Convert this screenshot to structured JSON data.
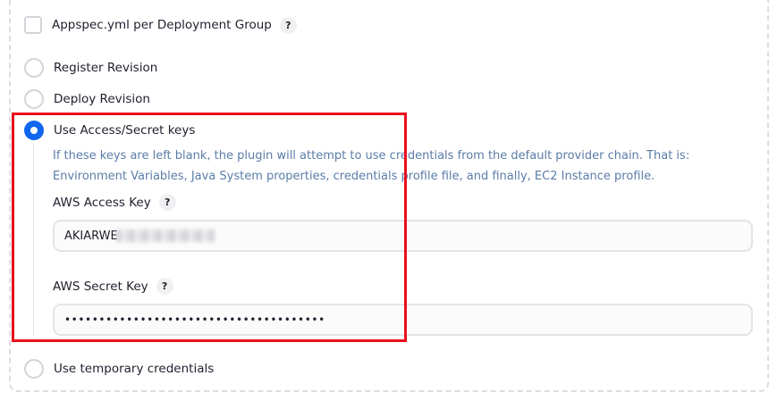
{
  "options": {
    "appspec_per_group": {
      "label": "Appspec.yml per Deployment Group",
      "help": "?"
    },
    "register_revision": {
      "label": "Register Revision"
    },
    "deploy_revision": {
      "label": "Deploy Revision"
    },
    "use_access_keys": {
      "label": "Use Access/Secret keys",
      "description": "If these keys are left blank, the plugin will attempt to use credentials from the default provider chain. That is: Environment Variables, Java System properties, credentials profile file, and finally, EC2 Instance profile."
    },
    "use_temp_credentials": {
      "label": "Use temporary credentials"
    }
  },
  "fields": {
    "access_key": {
      "label": "AWS Access Key",
      "help": "?",
      "value": "AKIARWE"
    },
    "secret_key": {
      "label": "AWS Secret Key",
      "help": "?",
      "value": "••••••••••••••••••••••••••••••••••••••"
    }
  },
  "colors": {
    "accent": "#1166ee",
    "highlight": "#e8101c",
    "description": "#5b7ca8"
  }
}
